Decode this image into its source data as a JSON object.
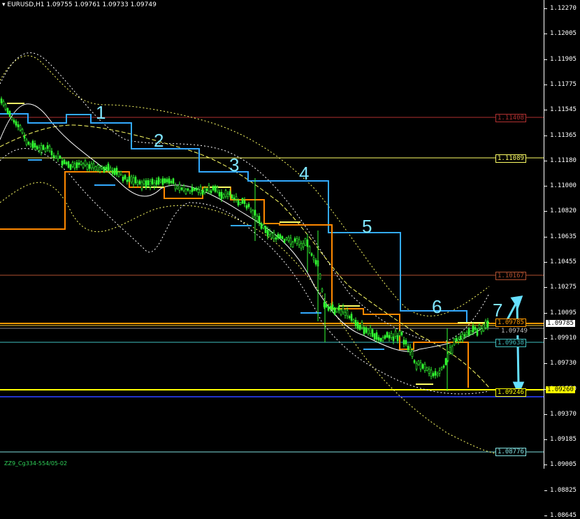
{
  "header": {
    "symbol_line": "▾ EURUSD,H1  1.09755 1.09761 1.09733 1.09749"
  },
  "price_axis": {
    "labels": [
      "1.12270",
      "1.12005",
      "1.11905",
      "1.11775",
      "1.11545",
      "1.11365",
      "1.11180",
      "1.11000",
      "1.10820",
      "1.10635",
      "1.10455",
      "1.10275",
      "1.10095",
      "1.09910",
      "1.09730",
      "1.09550",
      "1.09370",
      "1.09185",
      "1.09005",
      "1.08825",
      "1.08645"
    ],
    "current_price": "1.09785",
    "support_price": "1.09260"
  },
  "levels": [
    {
      "name": "level-1-11408",
      "label": "1.11408",
      "color": "#b03030"
    },
    {
      "name": "level-1-11089",
      "label": "1.11089",
      "color": "#ffff66"
    },
    {
      "name": "level-1-10167",
      "label": "1.10167",
      "color": "#b05030"
    },
    {
      "name": "level-1-09785",
      "label": "1.09785",
      "color": "#ff9900"
    },
    {
      "name": "level-1-09749",
      "label": "1.09749",
      "color": "#c0c0c0"
    },
    {
      "name": "level-1-09638",
      "label": "1.09638",
      "color": "#40c0c0"
    },
    {
      "name": "level-1-09246",
      "label": "1.09246",
      "color": "#ffff00"
    },
    {
      "name": "level-1-08776",
      "label": "1.08776",
      "color": "#80e0e0"
    }
  ],
  "wave_labels": [
    "1",
    "2",
    "3",
    "4",
    "5",
    "6",
    "7"
  ],
  "footer": "ZZ9_Cg334-554/05-02",
  "colors": {
    "background": "#000000",
    "candle_green": "#33ff33",
    "staircase_blue": "#33aaff",
    "staircase_orange": "#ff8800",
    "ma_yellow": "#ffff66",
    "ma_white": "#ffffff",
    "arrow_cyan": "#66e0ff"
  }
}
